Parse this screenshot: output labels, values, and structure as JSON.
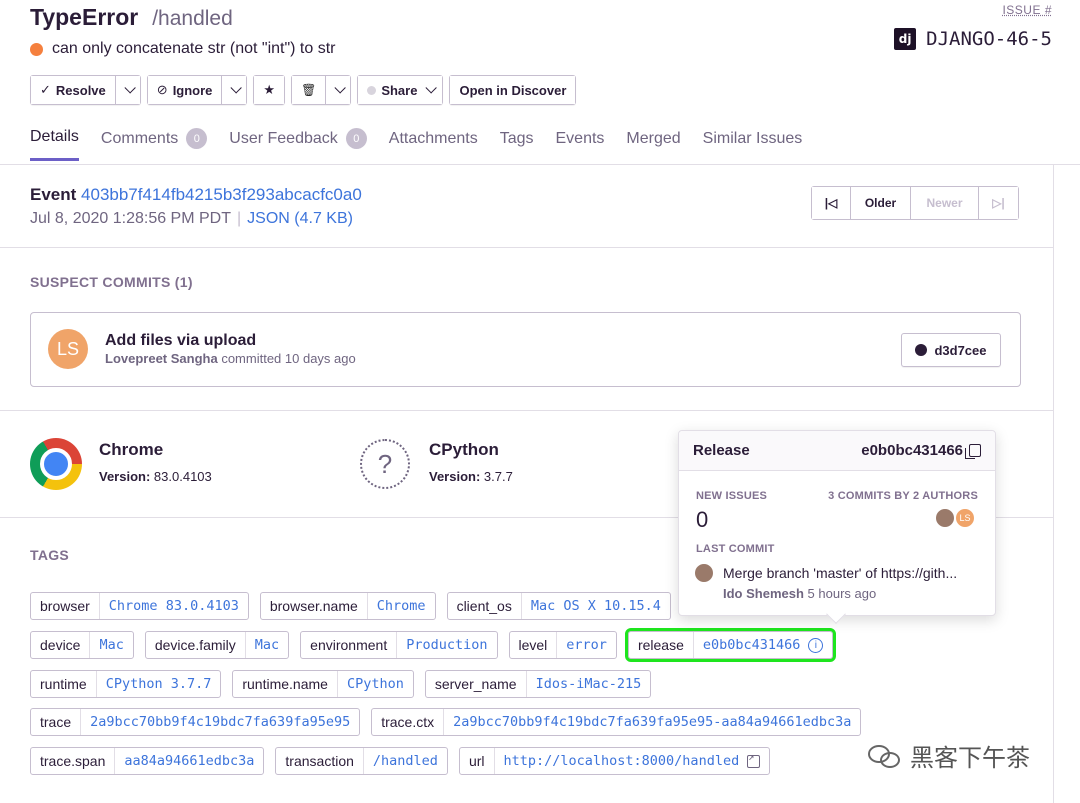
{
  "issue": {
    "type": "TypeError",
    "culprit": "/handled",
    "message": "can only concatenate str (not \"int\") to str",
    "number_label": "ISSUE #",
    "logo_text": "dj",
    "short_id": "DJANGO-46-5"
  },
  "toolbar": {
    "resolve": "Resolve",
    "ignore": "Ignore",
    "share": "Share",
    "discover": "Open in Discover",
    "check_glyph": "✓",
    "ignore_glyph": "⊘",
    "star_glyph": "★",
    "trash_glyph": "🗑"
  },
  "tabs": [
    {
      "label": "Details"
    },
    {
      "label": "Comments",
      "badge": "0"
    },
    {
      "label": "User Feedback",
      "badge": "0"
    },
    {
      "label": "Attachments"
    },
    {
      "label": "Tags"
    },
    {
      "label": "Events"
    },
    {
      "label": "Merged"
    },
    {
      "label": "Similar Issues"
    }
  ],
  "event": {
    "label": "Event",
    "id": "403bb7f414fb4215b3f293abcacfc0a0",
    "date": "Jul 8, 2020 1:28:56 PM PDT",
    "separator": "|",
    "json_link": "JSON (4.7 KB)"
  },
  "pager": {
    "first_glyph": "|◁",
    "older": "Older",
    "newer": "Newer",
    "last_glyph": "▷|"
  },
  "suspect_commits": {
    "title": "SUSPECT COMMITS (1)",
    "avatar_initials": "LS",
    "message": "Add files via upload",
    "author": "Lovepreet Sangha",
    "when": " committed 10 days ago",
    "sha": "d3d7cee"
  },
  "contexts": {
    "browser": {
      "name": "Chrome",
      "version_label": "Version:",
      "version": "83.0.4103"
    },
    "runtime": {
      "name": "CPython",
      "version_label": "Version:",
      "version": "3.7.7",
      "glyph": "?"
    }
  },
  "tags": {
    "title": "TAGS",
    "rows": [
      [
        {
          "key": "browser",
          "value": "Chrome 83.0.4103"
        },
        {
          "key": "browser.name",
          "value": "Chrome"
        },
        {
          "key": "client_os",
          "value": "Mac OS X 10.15.4"
        }
      ],
      [
        {
          "key": "device",
          "value": "Mac"
        },
        {
          "key": "device.family",
          "value": "Mac"
        },
        {
          "key": "environment",
          "value": "Production"
        },
        {
          "key": "level",
          "value": "error"
        },
        {
          "key": "release",
          "value": "e0b0bc431466"
        }
      ],
      [
        {
          "key": "runtime",
          "value": "CPython 3.7.7"
        },
        {
          "key": "runtime.name",
          "value": "CPython"
        },
        {
          "key": "server_name",
          "value": "Idos-iMac-215"
        }
      ],
      [
        {
          "key": "trace",
          "value": "2a9bcc70bb9f4c19bdc7fa639fa95e95"
        },
        {
          "key": "trace.ctx",
          "value": "2a9bcc70bb9f4c19bdc7fa639fa95e95-aa84a94661edbc3a"
        }
      ],
      [
        {
          "key": "trace.span",
          "value": "aa84a94661edbc3a"
        },
        {
          "key": "transaction",
          "value": "/handled"
        },
        {
          "key": "url",
          "value": "http://localhost:8000/handled"
        }
      ]
    ],
    "info_glyph": "i"
  },
  "release_popover": {
    "title": "Release",
    "sha": "e0b0bc431466",
    "new_issues_label": "NEW ISSUES",
    "new_issues": "0",
    "commits_label": "3 COMMITS BY 2 AUTHORS",
    "author2_initials": "LS",
    "last_commit_label": "LAST COMMIT",
    "last_commit_message": "Merge branch 'master' of https://gith...",
    "last_commit_author": "Ido Shemesh",
    "last_commit_when": " 5 hours ago"
  },
  "watermark": {
    "text": "黑客下午茶"
  },
  "colors": {
    "accent": "#6c5fc7",
    "link": "#3d74db",
    "error_dot": "#f5803e",
    "highlight": "#1ee51e"
  }
}
